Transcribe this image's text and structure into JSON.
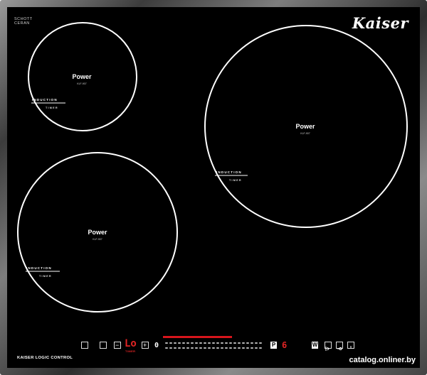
{
  "brand": {
    "small_line1": "SCHOTT",
    "small_line2": "CERAN",
    "logo": "Kaiser"
  },
  "zones": [
    {
      "id": "top-left",
      "power_label": "Power",
      "sub_label": "KLF-907",
      "induction_label": "INDUCTION",
      "timer_label": "TIMER"
    },
    {
      "id": "right",
      "power_label": "Power",
      "sub_label": "KLF-907",
      "induction_label": "INDUCTION",
      "timer_label": "TIMER"
    },
    {
      "id": "bottom-left",
      "power_label": "Power",
      "sub_label": "KLF-907",
      "induction_label": "INDUCTION",
      "timer_label": "TIMER"
    }
  ],
  "control_panel": {
    "label": "KAISER LOGIC CONTROL",
    "minus_symbol": "−",
    "plus_symbol": "+",
    "display_left": "Lo",
    "display_left_timer": "TIMER",
    "power_indicator": "0",
    "pause_symbol": "P",
    "level_display": "6",
    "wok_symbol": "W",
    "colors": {
      "accent_red": "#d7151c",
      "glass": "#000000",
      "frame": "#6e6e6e"
    },
    "icons": [
      "power-icon",
      "zone-select-icon",
      "lock-icon",
      "boost-icon",
      "keep-warm-icon"
    ]
  },
  "watermark": "catalog.onliner.by"
}
